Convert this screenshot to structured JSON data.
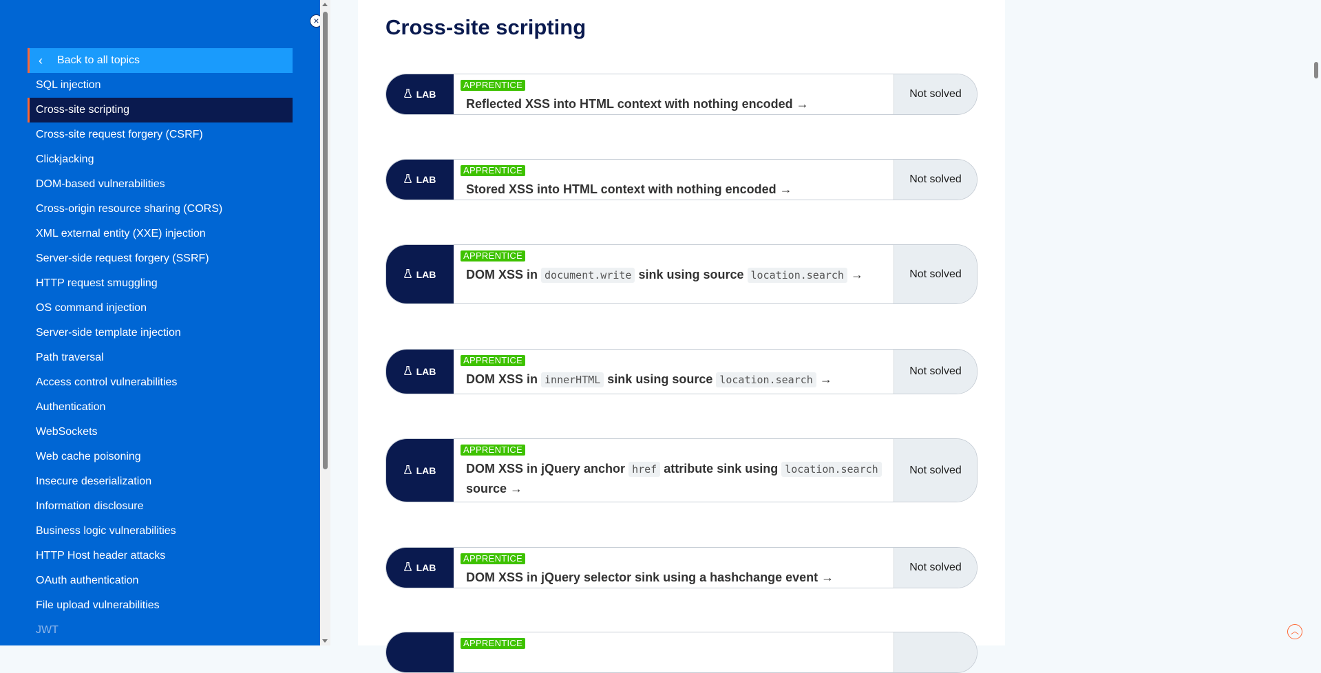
{
  "sidebar": {
    "back_label": "Back to all topics",
    "items": [
      {
        "label": "SQL injection"
      },
      {
        "label": "Cross-site scripting",
        "active": true
      },
      {
        "label": "Cross-site request forgery (CSRF)"
      },
      {
        "label": "Clickjacking"
      },
      {
        "label": "DOM-based vulnerabilities"
      },
      {
        "label": "Cross-origin resource sharing (CORS)"
      },
      {
        "label": "XML external entity (XXE) injection"
      },
      {
        "label": "Server-side request forgery (SSRF)"
      },
      {
        "label": "HTTP request smuggling"
      },
      {
        "label": "OS command injection"
      },
      {
        "label": "Server-side template injection"
      },
      {
        "label": "Path traversal"
      },
      {
        "label": "Access control vulnerabilities"
      },
      {
        "label": "Authentication"
      },
      {
        "label": "WebSockets"
      },
      {
        "label": "Web cache poisoning"
      },
      {
        "label": "Insecure deserialization"
      },
      {
        "label": "Information disclosure"
      },
      {
        "label": "Business logic vulnerabilities"
      },
      {
        "label": "HTTP Host header attacks"
      },
      {
        "label": "OAuth authentication"
      },
      {
        "label": "File upload vulnerabilities"
      },
      {
        "label": "JWT",
        "faded": true
      }
    ],
    "close_icon": "close-icon"
  },
  "main": {
    "title": "Cross-site scripting",
    "labs": [
      {
        "tag": "LAB",
        "level": "APPRENTICE",
        "status": "Not solved",
        "title": [
          {
            "t": "Reflected XSS into HTML context with nothing encoded →"
          }
        ]
      },
      {
        "tag": "LAB",
        "level": "APPRENTICE",
        "status": "Not solved",
        "title": [
          {
            "t": "Stored XSS into HTML context with nothing encoded →"
          }
        ]
      },
      {
        "tag": "LAB",
        "level": "APPRENTICE",
        "status": "Not solved",
        "title": [
          {
            "t": "DOM XSS in "
          },
          {
            "c": "document.write"
          },
          {
            "t": " sink using source "
          },
          {
            "c": "location.search"
          },
          {
            "t": " →"
          }
        ]
      },
      {
        "tag": "LAB",
        "level": "APPRENTICE",
        "status": "Not solved",
        "title": [
          {
            "t": "DOM XSS in "
          },
          {
            "c": "innerHTML"
          },
          {
            "t": " sink using source "
          },
          {
            "c": "location.search"
          },
          {
            "t": " →"
          }
        ]
      },
      {
        "tag": "LAB",
        "level": "APPRENTICE",
        "status": "Not solved",
        "title": [
          {
            "t": "DOM XSS in jQuery anchor "
          },
          {
            "c": "href"
          },
          {
            "t": " attribute sink using "
          },
          {
            "c": "location.search"
          },
          {
            "t": " source →"
          }
        ]
      },
      {
        "tag": "LAB",
        "level": "APPRENTICE",
        "status": "Not solved",
        "title": [
          {
            "t": "DOM XSS in jQuery selector sink using a hashchange event →"
          }
        ]
      },
      {
        "tag": "",
        "level": "APPRENTICE",
        "status": "",
        "title": []
      }
    ]
  },
  "colors": {
    "sidebar_bg": "#0066d4",
    "active_bg": "#0a1a4f",
    "accent": "#ff6633",
    "badge_green": "#3ec200",
    "title_navy": "#0a1a4f"
  }
}
